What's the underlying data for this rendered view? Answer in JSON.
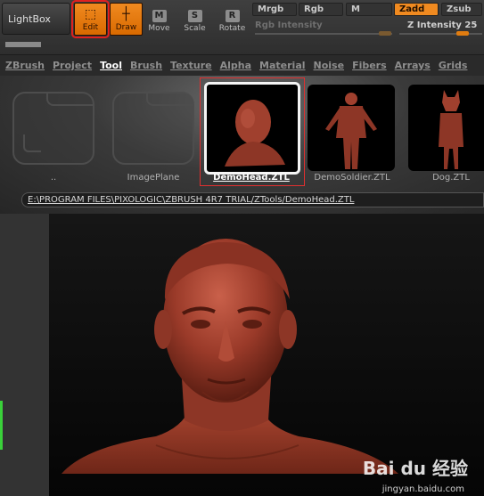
{
  "toolbar": {
    "lightbox": "LightBox",
    "edit": "Edit",
    "draw": "Draw",
    "move": "Move",
    "scale": "Scale",
    "rotate": "Rotate",
    "move_icon": "M",
    "scale_icon": "S",
    "rotate_icon": "R",
    "mrgb": "Mrgb",
    "rgb": "Rgb",
    "m": "M",
    "zadd": "Zadd",
    "zsub": "Zsub",
    "rgb_intensity": "Rgb Intensity",
    "z_intensity_label": "Z Intensity",
    "z_intensity_value": "25",
    "accent": "#f08a20"
  },
  "menu": [
    "ZBrush",
    "Project",
    "Tool",
    "Brush",
    "Texture",
    "Alpha",
    "Material",
    "Noise",
    "Fibers",
    "Arrays",
    "Grids"
  ],
  "menu_active": "Tool",
  "tools": [
    {
      "label": ".."
    },
    {
      "label": "ImagePlane"
    },
    {
      "label": "DemoHead.ZTL"
    },
    {
      "label": "DemoSoldier.ZTL"
    },
    {
      "label": "Dog.ZTL"
    }
  ],
  "path": "E:\\PROGRAM FILES\\PIXOLOGIC\\ZBRUSH 4R7 TRIAL/ZTools/DemoHead.ZTL",
  "watermark": {
    "logo": "Bai du 经验",
    "url": "jingyan.baidu.com"
  }
}
